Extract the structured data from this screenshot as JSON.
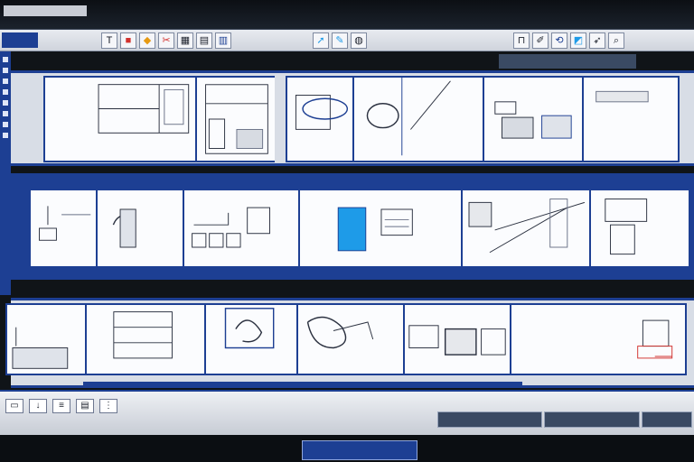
{
  "window": {
    "app_label": "",
    "title": ""
  },
  "toolbar": {
    "file_menu": "",
    "left_icons": [
      "text-icon",
      "image-icon",
      "paint-icon",
      "cut-icon",
      "table-icon",
      "grid-icon",
      "chart-icon"
    ],
    "mid_icons": [
      "arrow-icon",
      "pen-icon",
      "globe-icon"
    ],
    "right_icons": [
      "lock-icon",
      "pencil-icon",
      "connect-icon",
      "shape-icon",
      "cursor-icon",
      "zoom-icon"
    ]
  },
  "status": {
    "top": "",
    "segments": [
      "",
      "",
      ""
    ]
  },
  "rows": [
    {
      "label": "",
      "frames": [
        "",
        "",
        "",
        "",
        "",
        ""
      ]
    },
    {
      "label": "",
      "frames": [
        "",
        "",
        "",
        "",
        "",
        ""
      ]
    },
    {
      "label": "",
      "frames": [
        "",
        "",
        "",
        "",
        "",
        ""
      ]
    }
  ],
  "taskbar": {
    "active_task": ""
  },
  "colors": {
    "accent": "#1d3f93",
    "highlight": "#1e9be8",
    "sketch": "#2b3140",
    "annotation": "#d2312d"
  }
}
